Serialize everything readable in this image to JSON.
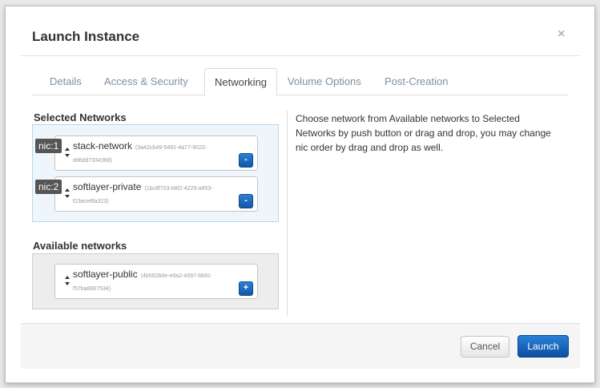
{
  "modal": {
    "title": "Launch Instance",
    "close_symbol": "×"
  },
  "tabs": [
    {
      "label": "Details",
      "active": false
    },
    {
      "label": "Access & Security",
      "active": false
    },
    {
      "label": "Networking",
      "active": true
    },
    {
      "label": "Volume Options",
      "active": false
    },
    {
      "label": "Post-Creation",
      "active": false
    }
  ],
  "selected_networks": {
    "title": "Selected Networks",
    "items": [
      {
        "nic": "nic:1",
        "name": "stack-network",
        "id_part1": "(3a42cb49-5491-4a77-9023-",
        "id_part2": "dd6dd7334368)",
        "button": "-"
      },
      {
        "nic": "nic:2",
        "name": "softlayer-private",
        "id_part1": "(1bc8f703-b8f2-4229-a953-",
        "id_part2": "f23ace8fa323)",
        "button": "-"
      }
    ]
  },
  "available_networks": {
    "title": "Available networks",
    "items": [
      {
        "name": "softlayer-public",
        "id_part1": "(4b592b0e-e9a2-4397-bb91-",
        "id_part2": "f57ba8867534)",
        "button": "+"
      }
    ]
  },
  "help": {
    "text": "Choose network from Available networks to Selected Networks by push button or drag and drop, you may change nic order by drag and drop as well."
  },
  "footer": {
    "cancel_label": "Cancel",
    "launch_label": "Launch"
  },
  "colors": {
    "primary_button": "#1a66bf",
    "selected_box_bg": "#eef6fc",
    "available_box_bg": "#ededed",
    "nic_badge": "#555555"
  }
}
